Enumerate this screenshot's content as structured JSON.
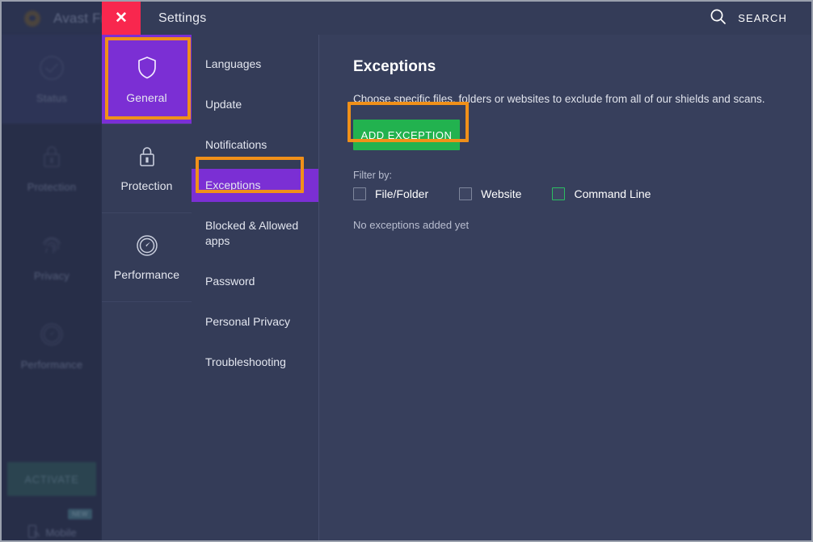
{
  "background_app": {
    "title": "Avast Free A",
    "logo_icon": "avast-logo-icon",
    "nav": [
      {
        "label": "Status",
        "icon": "check-circle-icon"
      },
      {
        "label": "Protection",
        "icon": "lock-icon"
      },
      {
        "label": "Privacy",
        "icon": "fingerprint-icon"
      },
      {
        "label": "Performance",
        "icon": "speedometer-icon"
      }
    ],
    "activate_label": "ACTIVATE",
    "mobile_label": "Mobile",
    "mobile_icon": "mobile-phone-icon",
    "new_badge": "NEW"
  },
  "settings_window": {
    "close_icon": "close-x-icon",
    "title": "Settings",
    "search": {
      "icon": "search-icon",
      "label": "SEARCH"
    },
    "categories": [
      {
        "label": "General",
        "icon": "shield-icon",
        "selected": true
      },
      {
        "label": "Protection",
        "icon": "lock-icon",
        "selected": false
      },
      {
        "label": "Performance",
        "icon": "speedometer-icon",
        "selected": false
      }
    ],
    "subnav": [
      {
        "label": "Languages",
        "selected": false
      },
      {
        "label": "Update",
        "selected": false
      },
      {
        "label": "Notifications",
        "selected": false
      },
      {
        "label": "Exceptions",
        "selected": true
      },
      {
        "label": "Blocked & Allowed apps",
        "selected": false
      },
      {
        "label": "Password",
        "selected": false
      },
      {
        "label": "Personal Privacy",
        "selected": false
      },
      {
        "label": "Troubleshooting",
        "selected": false
      }
    ]
  },
  "main": {
    "title": "Exceptions",
    "description": "Choose specific files, folders or websites to exclude from all of our shields and scans.",
    "add_button": "ADD EXCEPTION",
    "filter_label": "Filter by:",
    "filters": [
      {
        "label": "File/Folder",
        "checked": false,
        "highlighted": false
      },
      {
        "label": "Website",
        "checked": false,
        "highlighted": false
      },
      {
        "label": "Command Line",
        "checked": false,
        "highlighted": true
      }
    ],
    "empty_message": "No exceptions added yet"
  },
  "annotations": {
    "highlight_color": "#f09019",
    "boxes": [
      "general-category",
      "exceptions-subnav-item",
      "add-exception-button"
    ]
  },
  "colors": {
    "accent_purple": "#7b2fd4",
    "close_red": "#f8274e",
    "green_button": "#22b24f",
    "panel_bg": "#373f5c",
    "rail_bg": "#343c58",
    "checkbox_highlight": "#2bbd62"
  }
}
